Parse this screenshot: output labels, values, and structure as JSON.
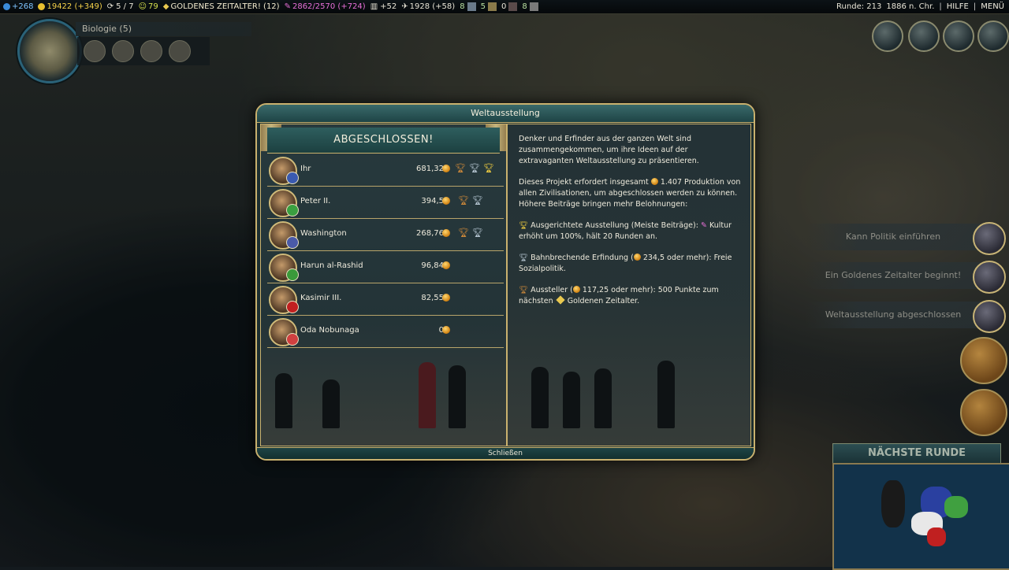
{
  "topbar": {
    "science": "+268",
    "gold": "19422 (+349)",
    "trade_routes": "5 / 7",
    "happiness": "79",
    "golden_age": "GOLDENES ZEITALTER! (12)",
    "culture": "2862/2570 (+724)",
    "tourism": "+52",
    "faith": "1928 (+58)",
    "res1": "8",
    "res2": "5",
    "res3": "0",
    "res4": "8",
    "turn": "Runde: 213",
    "year": "1886 n. Chr.",
    "help": "HILFE",
    "menu": "MENÜ"
  },
  "research": {
    "title": "Biologie (5)"
  },
  "notifications": [
    {
      "label": "Kann Politik einführen"
    },
    {
      "label": "Ein Goldenes Zeitalter beginnt!"
    },
    {
      "label": "Weltausstellung abgeschlossen"
    }
  ],
  "next_turn": "NÄCHSTE RUNDE",
  "dialog": {
    "title": "Weltausstellung",
    "banner": "ABGESCHLOSSEN!",
    "close": "Schließen",
    "rows": [
      {
        "name": "Ihr",
        "value": "681,32",
        "badge_color": "#3a5ab0"
      },
      {
        "name": "Peter II.",
        "value": "394,5",
        "badge_color": "#3aa040"
      },
      {
        "name": "Washington",
        "value": "268,76",
        "badge_color": "#4a5aa8"
      },
      {
        "name": "Harun al-Rashid",
        "value": "96,84",
        "badge_color": "#3a9a3a"
      },
      {
        "name": "Kasimir III.",
        "value": "82,55",
        "badge_color": "#c02020"
      },
      {
        "name": "Oda Nobunaga",
        "value": "0",
        "badge_color": "#d04040"
      }
    ],
    "desc": {
      "p1": "Denker und Erfinder aus der ganzen Welt sind zusammengekommen, um ihre Ideen auf der extravaganten Weltausstellung zu präsentieren.",
      "p2a": "Dieses Projekt erfordert insgesamt",
      "p2b": "1.407 Produktion von allen Zivilisationen, um abgeschlossen werden zu können. Höhere Beiträge bringen mehr Belohnungen:",
      "p3a": "Ausgerichtete Ausstellung (Meiste Beiträge):",
      "p3b": "Kultur erhöht um 100%, hält 20 Runden an.",
      "p4a": "Bahnbrechende Erfindung (",
      "p4b": "234,5 oder mehr): Freie Sozialpolitik.",
      "p5a": "Aussteller (",
      "p5b": "117,25 oder mehr): 500 Punkte zum nächsten",
      "p5c": "Goldenen Zeitalter."
    }
  },
  "colors": {
    "accent_border": "#c9b16e",
    "panel_teal": "#1e4446",
    "science": "#7fc4ff",
    "gold": "#f6d24a",
    "culture": "#e870d8"
  }
}
